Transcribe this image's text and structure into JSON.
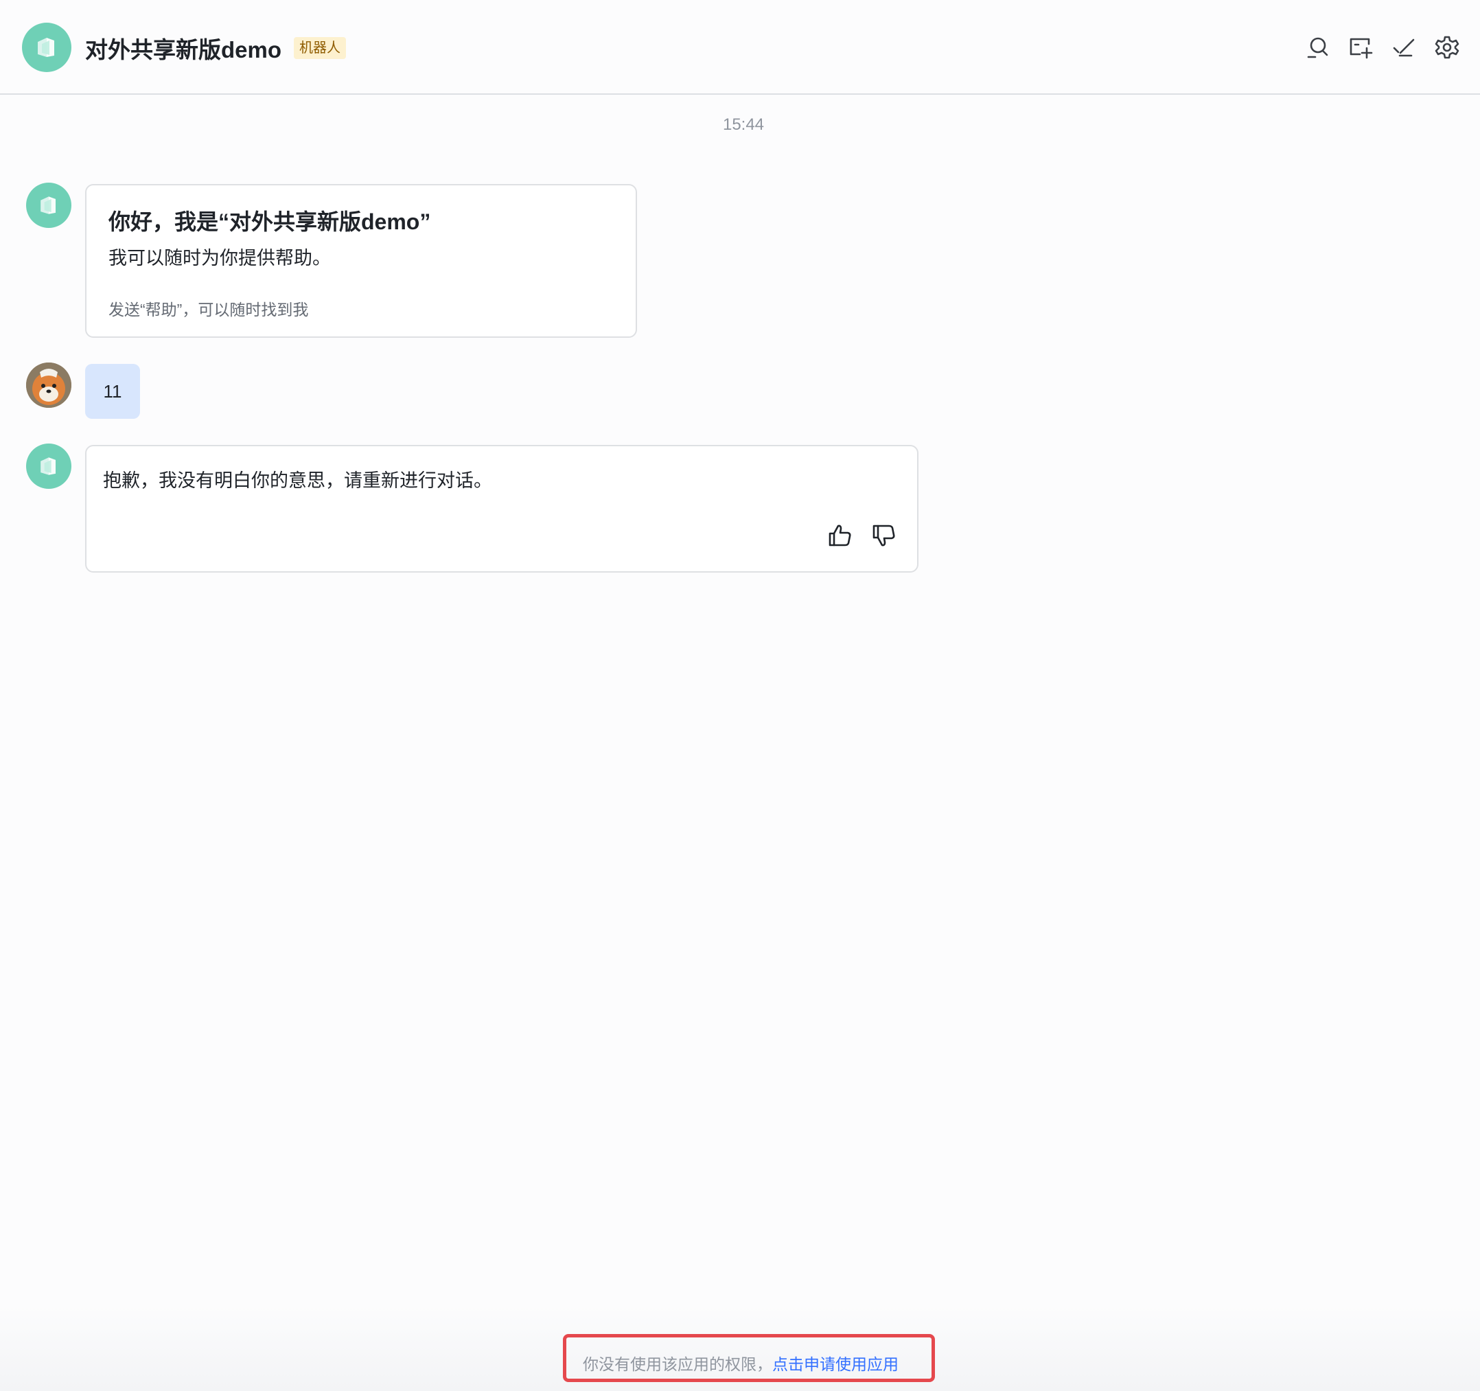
{
  "header": {
    "title": "对外共享新版demo",
    "badge": "机器人",
    "icons": [
      "search-icon",
      "new-topic-icon",
      "check-icon",
      "settings-icon"
    ]
  },
  "chat": {
    "timestamp": "15:44",
    "welcome": {
      "title": "你好，我是“对外共享新版demo”",
      "subtitle": "我可以随时为你提供帮助。",
      "hint": "发送“帮助”，可以随时找到我"
    },
    "user_message": "11",
    "bot_reply": "抱歉，我没有明白你的意思，请重新进行对话。"
  },
  "footer": {
    "notice": "你没有使用该应用的权限，",
    "link": "点击申请使用应用"
  },
  "colors": {
    "bot_avatar": "#6fd0b6",
    "user_bubble": "#d8e6fd",
    "link": "#3370ff",
    "highlight_border": "#e5484d",
    "badge_bg": "#fdf1cf"
  }
}
